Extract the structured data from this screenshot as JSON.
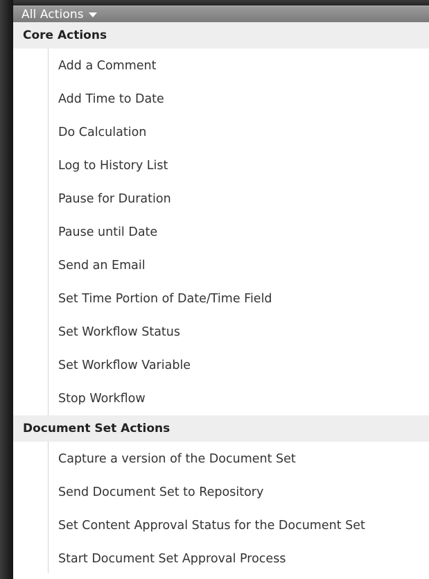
{
  "dropdown": {
    "label": "All Actions"
  },
  "groups": [
    {
      "title": "Core Actions",
      "items": [
        "Add a Comment",
        "Add Time to Date",
        "Do Calculation",
        "Log to History List",
        "Pause for Duration",
        "Pause until Date",
        "Send an Email",
        "Set Time Portion of Date/Time Field",
        "Set Workflow Status",
        "Set Workflow Variable",
        "Stop Workflow"
      ]
    },
    {
      "title": "Document Set Actions",
      "items": [
        "Capture a version of the Document Set",
        "Send Document Set to Repository",
        "Set Content Approval Status for the Document Set",
        "Start Document Set Approval Process"
      ]
    }
  ],
  "colors": {
    "header_bg": "#8a8a8a",
    "group_bg": "#eeeeee",
    "panel_bg": "#ffffff",
    "frame_bg": "#2d2d2d"
  },
  "icons": {
    "dropdown_caret": "caret-down-icon"
  }
}
